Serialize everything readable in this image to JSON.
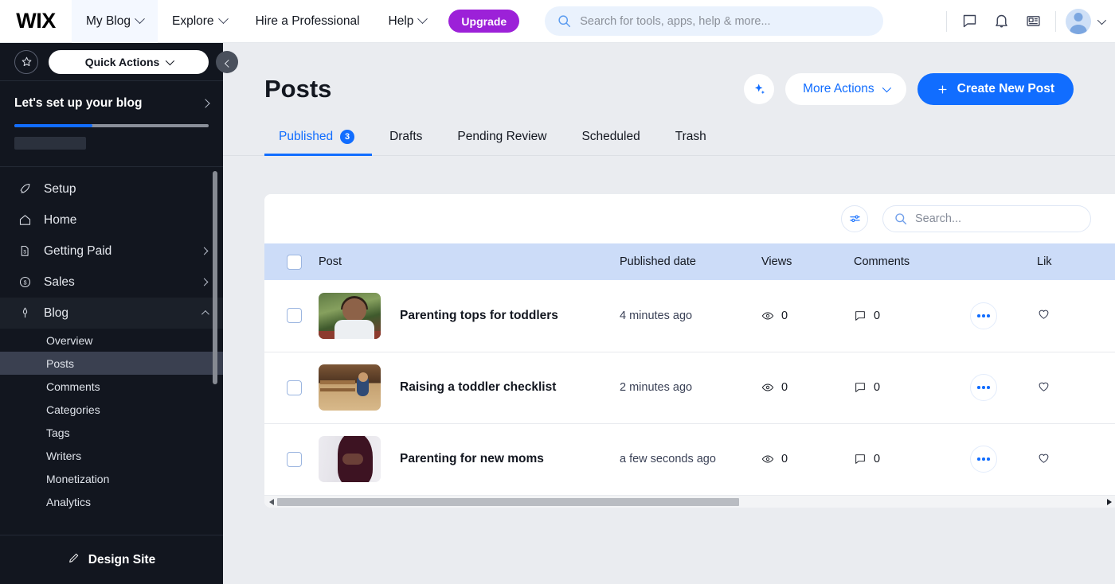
{
  "topbar": {
    "logo": "WIX",
    "nav": [
      {
        "label": "My Blog",
        "has_chevron": true,
        "active": true
      },
      {
        "label": "Explore",
        "has_chevron": true,
        "active": false
      },
      {
        "label": "Hire a Professional",
        "has_chevron": false,
        "active": false
      },
      {
        "label": "Help",
        "has_chevron": true,
        "active": false
      }
    ],
    "upgrade_label": "Upgrade",
    "upgrade_color": "#9c21d8",
    "search_placeholder": "Search for tools, apps, help & more...",
    "search_value": "",
    "icons": [
      "chat-icon",
      "bell-icon",
      "news-icon"
    ]
  },
  "sidebar": {
    "star_icon": "star-outline-icon",
    "quick_actions_label": "Quick Actions",
    "setup": {
      "title": "Let's set up your blog",
      "progress_percent": 40,
      "progress_color": "#116dff"
    },
    "nav": [
      {
        "label": "Setup",
        "icon": "rocket-icon",
        "expandable": false
      },
      {
        "label": "Home",
        "icon": "home-icon",
        "expandable": false
      },
      {
        "label": "Getting Paid",
        "icon": "invoice-icon",
        "expandable": true
      },
      {
        "label": "Sales",
        "icon": "dollar-circle-icon",
        "expandable": true
      },
      {
        "label": "Blog",
        "icon": "pen-icon",
        "expandable": true,
        "expanded": true
      }
    ],
    "blog_subitems": [
      {
        "label": "Overview",
        "selected": false
      },
      {
        "label": "Posts",
        "selected": true
      },
      {
        "label": "Comments",
        "selected": false
      },
      {
        "label": "Categories",
        "selected": false
      },
      {
        "label": "Tags",
        "selected": false
      },
      {
        "label": "Writers",
        "selected": false
      },
      {
        "label": "Monetization",
        "selected": false
      },
      {
        "label": "Analytics",
        "selected": false
      }
    ],
    "design_site_label": "Design Site"
  },
  "main": {
    "page_title": "Posts",
    "ai_button": "ai-sparkle-icon",
    "more_actions_label": "More Actions",
    "create_post_label": "Create New Post",
    "create_post_color": "#116dff",
    "tabs": [
      {
        "label": "Published",
        "badge": "3",
        "active": true
      },
      {
        "label": "Drafts",
        "badge": "",
        "active": false
      },
      {
        "label": "Pending Review",
        "badge": "",
        "active": false
      },
      {
        "label": "Scheduled",
        "badge": "",
        "active": false
      },
      {
        "label": "Trash",
        "badge": "",
        "active": false
      }
    ],
    "table_search_placeholder": "Search...",
    "table_search_value": "",
    "columns": {
      "post": "Post",
      "published_date": "Published date",
      "views": "Views",
      "comments": "Comments",
      "likes": "Lik"
    },
    "rows": [
      {
        "title": "Parenting tops for toddlers",
        "date": "4 minutes ago",
        "views": "0",
        "comments": "0",
        "thumb": "toddler-boy-photo"
      },
      {
        "title": "Raising a toddler checklist",
        "date": "2 minutes ago",
        "views": "0",
        "comments": "0",
        "thumb": "child-on-porch-photo"
      },
      {
        "title": "Parenting for new moms",
        "date": "a few seconds ago",
        "views": "0",
        "comments": "0",
        "thumb": "pregnancy-silhouette-photo"
      }
    ]
  }
}
